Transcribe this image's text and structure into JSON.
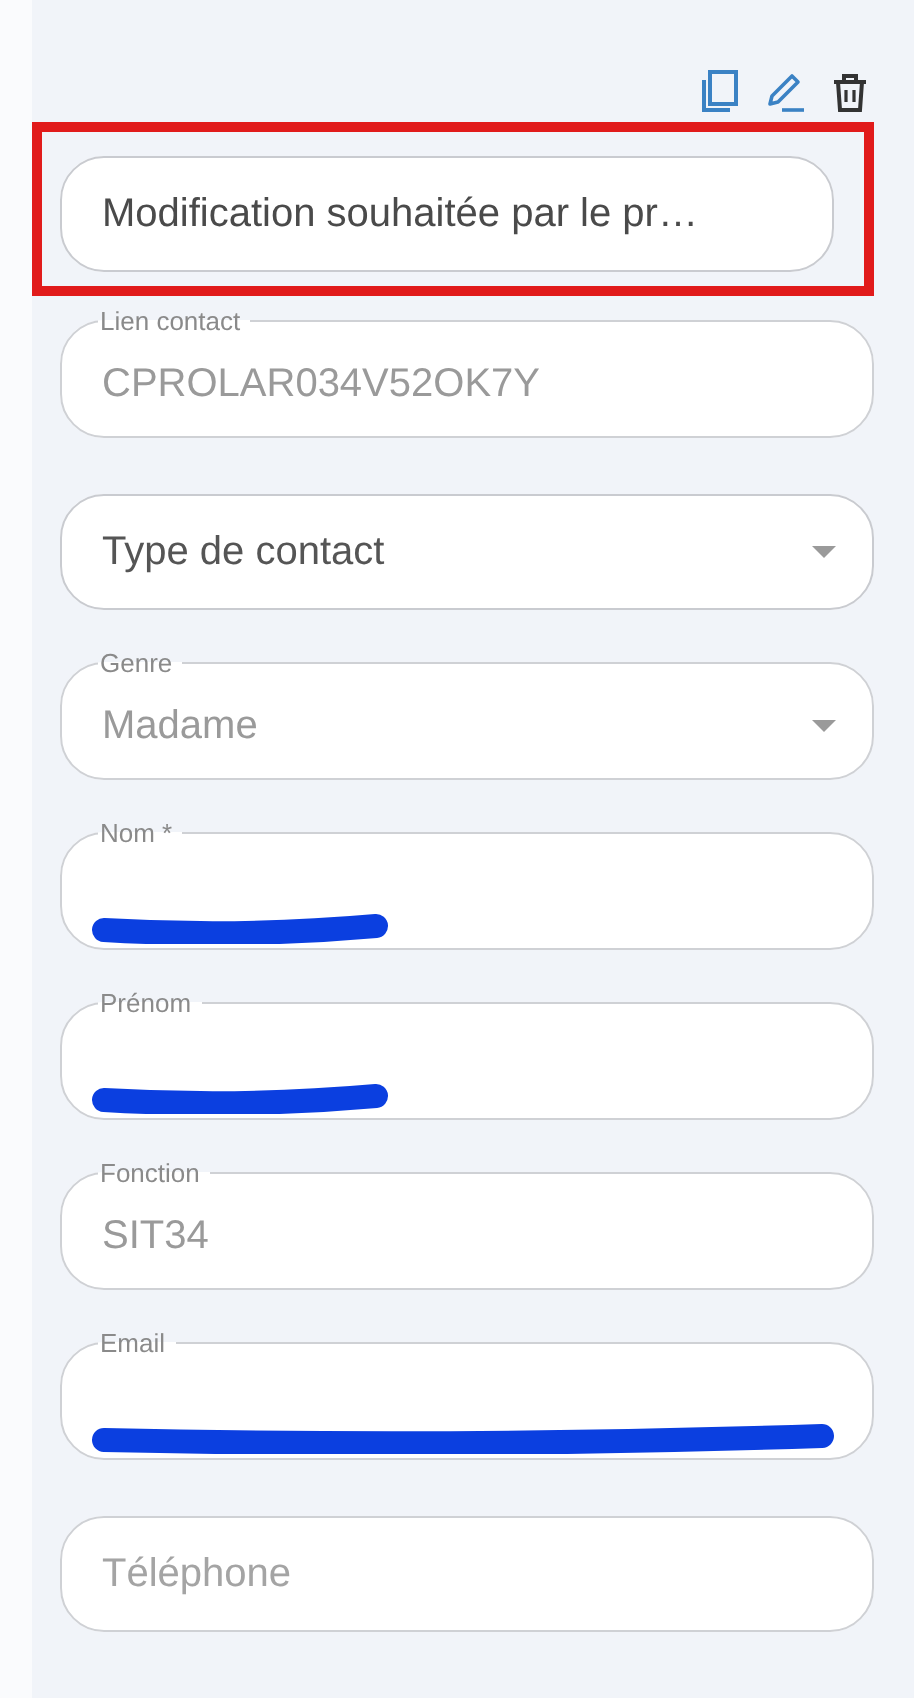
{
  "toolbar": {
    "actions": [
      {
        "kind": "copy"
      },
      {
        "kind": "edit"
      },
      {
        "kind": "delete"
      }
    ]
  },
  "fields": [
    {
      "kind": "text",
      "value": "Modification souhaitée par le pr…",
      "disabled": false,
      "highlighted": true
    },
    {
      "kind": "text",
      "label": "Lien contact",
      "value": "CPROLAR034V52OK7Y",
      "disabled": true
    },
    {
      "kind": "select",
      "placeholder": "Type de contact",
      "disabled": false
    },
    {
      "kind": "select",
      "label": "Genre",
      "value": "Madame",
      "disabled": true
    },
    {
      "kind": "text",
      "label": "Nom *",
      "disabled": true,
      "redacted": true
    },
    {
      "kind": "text",
      "label": "Prénom",
      "disabled": true,
      "redacted": true
    },
    {
      "kind": "text",
      "label": "Fonction",
      "value": "SIT34",
      "disabled": true
    },
    {
      "kind": "email",
      "label": "Email",
      "disabled": true,
      "redacted": true
    },
    {
      "kind": "text",
      "placeholder": "Téléphone",
      "disabled": true
    }
  ]
}
